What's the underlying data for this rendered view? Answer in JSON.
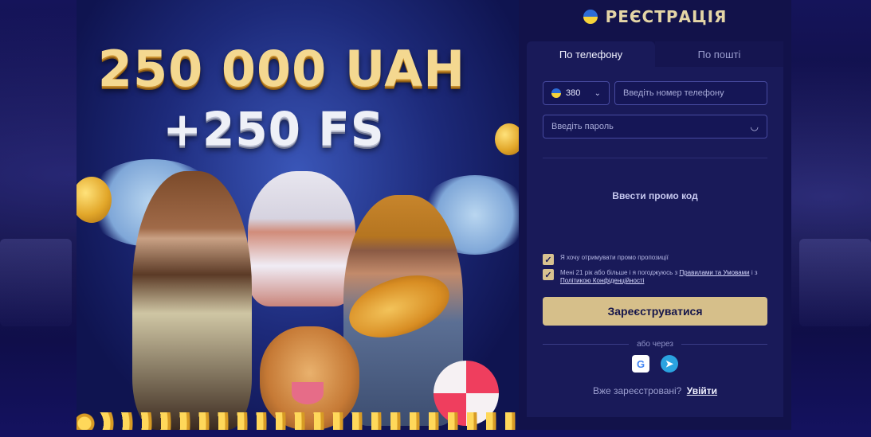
{
  "banner": {
    "headline_amount": "250 000 UAH",
    "headline_spins": "+250 FS"
  },
  "registration": {
    "title": "РЕЄСТРАЦІЯ",
    "flag_colors": [
      "#2c6cd6",
      "#f6d33a"
    ],
    "tabs": [
      {
        "label": "По телефону",
        "active": true
      },
      {
        "label": "По пошті",
        "active": false
      }
    ],
    "country_code": "380",
    "phone_placeholder": "Введіть номер телефону",
    "password_placeholder": "Введіть пароль",
    "eye_icon": "eye-closed-icon",
    "promo_link": "Ввести промо код",
    "checkboxes": [
      {
        "checked": true,
        "text": "Я хочу отримувати промо пропозиції"
      },
      {
        "checked": true,
        "text_prefix": "Мені 21 рік або більше і я погоджуюсь з",
        "terms_link": "Правилами та Умовами",
        "text_mid": "і з",
        "privacy_link": "Політикою Конфіденційності"
      }
    ],
    "submit_label": "Зареєструватися",
    "or_label": "або через",
    "socials": [
      "google-icon",
      "telegram-icon"
    ],
    "login_prompt": "Вже зареєстровані?",
    "login_link": "Увійти"
  },
  "colors": {
    "accent_gold": "#d6bf8a",
    "panel_bg": "#12124a",
    "form_bg": "#191a59"
  }
}
